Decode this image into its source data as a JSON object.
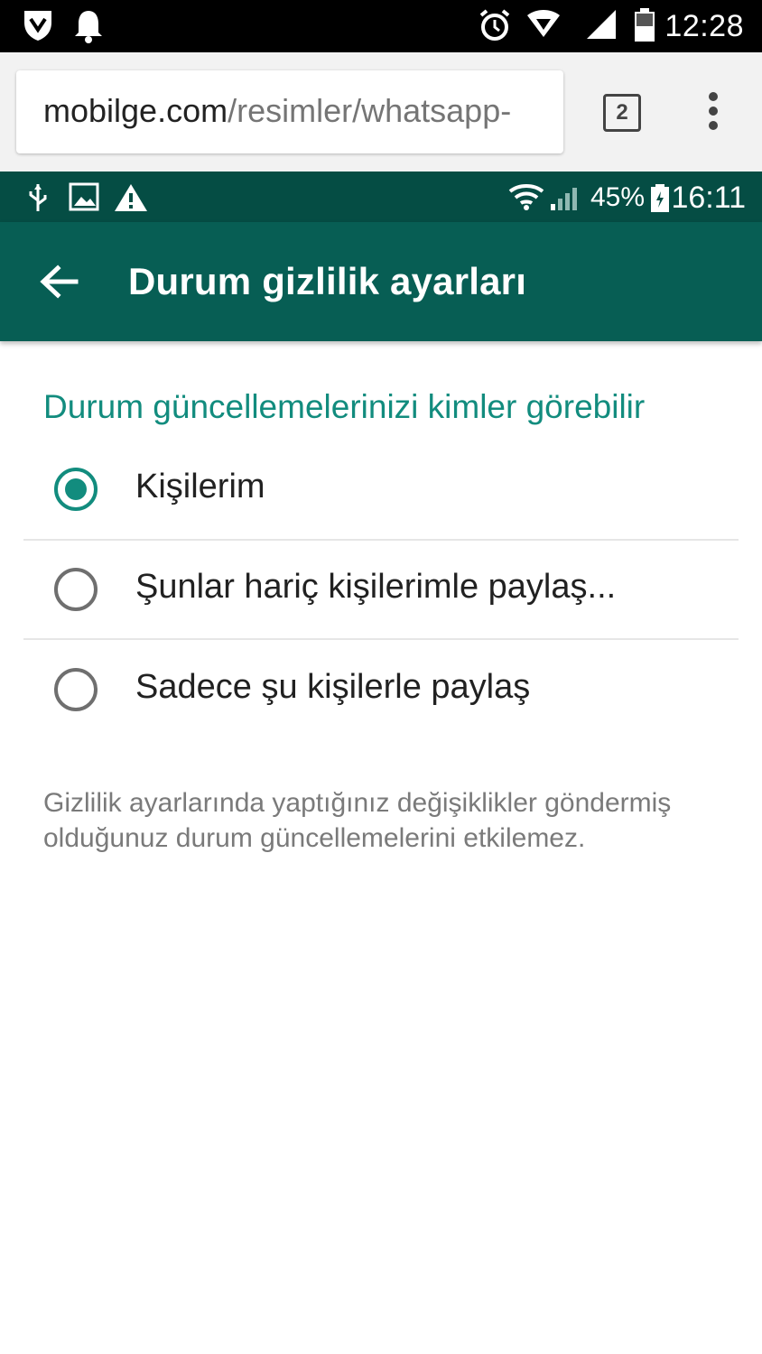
{
  "os_status": {
    "time": "12:28",
    "left_icons": [
      "shield-icon",
      "bell-icon"
    ],
    "right_icons": [
      "alarm-icon",
      "wifi-icon",
      "signal-icon",
      "battery-icon"
    ]
  },
  "browser": {
    "url_domain": "mobilge.com",
    "url_path": "/resimler/whatsapp-",
    "tab_count": "2"
  },
  "app_status": {
    "battery_percent": "45%",
    "time": "16:11",
    "left_icons": [
      "usb-icon",
      "image-icon",
      "warning-icon"
    ]
  },
  "app_bar": {
    "title": "Durum gizlilik ayarları",
    "background": "#075e54"
  },
  "content": {
    "section_title": "Durum güncellemelerinizi kimler görebilir",
    "accent": "#128c7e",
    "options": [
      {
        "label": "Kişilerim",
        "selected": true
      },
      {
        "label": "Şunlar hariç kişilerimle paylaş...",
        "selected": false
      },
      {
        "label": "Sadece şu kişilerle paylaş",
        "selected": false
      }
    ],
    "footnote": "Gizlilik ayarlarında yaptığınız değişiklikler göndermiş olduğunuz durum güncellemelerini etkilemez."
  }
}
